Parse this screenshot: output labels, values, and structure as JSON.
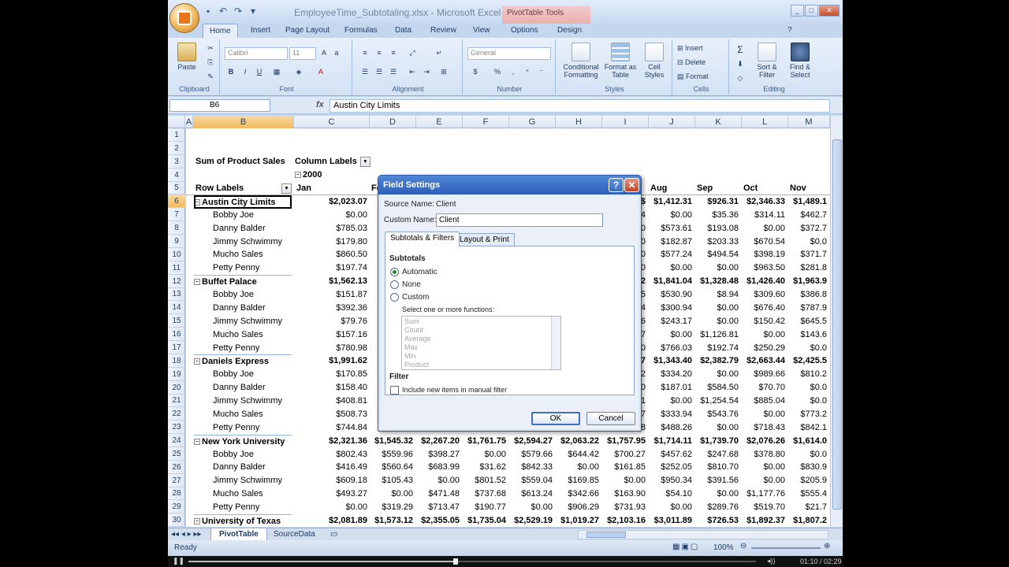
{
  "window": {
    "title": "EmployeeTime_Subtotaling.xlsx - Microsoft Excel",
    "context_tab": "PivotTable Tools"
  },
  "tabs": [
    "Home",
    "Insert",
    "Page Layout",
    "Formulas",
    "Data",
    "Review",
    "View",
    "Options",
    "Design"
  ],
  "ribbon": {
    "clipboard": {
      "label": "Clipboard",
      "paste": "Paste"
    },
    "font": {
      "label": "Font",
      "font_name": "Calibri",
      "font_size": "11"
    },
    "alignment": {
      "label": "Alignment"
    },
    "number": {
      "label": "Number",
      "format": "General"
    },
    "styles": {
      "label": "Styles",
      "conditional": "Conditional Formatting",
      "format_table": "Format as Table",
      "cell_styles": "Cell Styles"
    },
    "cells": {
      "label": "Cells",
      "insert": "Insert",
      "delete": "Delete",
      "format": "Format"
    },
    "editing": {
      "label": "Editing",
      "sort": "Sort & Filter",
      "find": "Find & Select"
    }
  },
  "formula_bar": {
    "name_box": "B6",
    "fx": "fx",
    "content": "Austin City Limits"
  },
  "columns": [
    "A",
    "B",
    "C",
    "D",
    "E",
    "F",
    "G",
    "H",
    "I",
    "J",
    "K",
    "L",
    "M"
  ],
  "rows": [
    "1",
    "2",
    "3",
    "4",
    "5",
    "6",
    "7",
    "8",
    "9",
    "10",
    "11",
    "12",
    "13",
    "14",
    "15",
    "16",
    "17",
    "18",
    "19",
    "20",
    "21",
    "22",
    "23",
    "24",
    "25",
    "26",
    "27",
    "28",
    "29",
    "30"
  ],
  "pivot": {
    "sum_label": "Sum of Product Sales",
    "col_labels": "Column Labels",
    "year": "2000",
    "row_labels": "Row Labels",
    "months": [
      "Jan",
      "Feb",
      "Mar",
      "Apr",
      "May",
      "Jun",
      "Jul",
      "Aug",
      "Sep",
      "Oct",
      "Nov"
    ],
    "rows": [
      {
        "label": "Austin City Limits",
        "type": "parent",
        "v": [
          "$2,023.07",
          "",
          "",
          "",
          "",
          "",
          "$",
          "$1,412.31",
          "$926.31",
          "$2,346.33",
          "$1,489.1"
        ]
      },
      {
        "label": "Bobby Joe",
        "type": "child",
        "v": [
          "$0.00",
          "",
          "",
          "",
          "",
          "",
          "4",
          "$0.00",
          "$35.36",
          "$314.11",
          "$462.7"
        ]
      },
      {
        "label": "Danny Balder",
        "type": "child",
        "v": [
          "$785.03",
          "",
          "",
          "",
          "",
          "",
          "0",
          "$573.61",
          "$193.08",
          "$0.00",
          "$372.7"
        ]
      },
      {
        "label": "Jimmy Schwimmy",
        "type": "child",
        "v": [
          "$179.80",
          "",
          "",
          "",
          "",
          "",
          "0",
          "$182.87",
          "$203.33",
          "$670.54",
          "$0.0"
        ]
      },
      {
        "label": "Mucho Sales",
        "type": "child",
        "v": [
          "$860.50",
          "",
          "",
          "",
          "",
          "",
          "0",
          "$577.24",
          "$494.54",
          "$398.19",
          "$371.7"
        ]
      },
      {
        "label": "Petty Penny",
        "type": "child",
        "v": [
          "$197.74",
          "",
          "",
          "",
          "",
          "",
          "0",
          "$0.00",
          "$0.00",
          "$963.50",
          "$281.8"
        ]
      },
      {
        "label": "Buffet Palace",
        "type": "parent",
        "v": [
          "$1,562.13",
          "",
          "",
          "",
          "",
          "",
          "2",
          "$1,841.04",
          "$1,328.48",
          "$1,426.40",
          "$1,963.9"
        ]
      },
      {
        "label": "Bobby Joe",
        "type": "child",
        "v": [
          "$151.87",
          "",
          "",
          "",
          "",
          "",
          "5",
          "$530.90",
          "$8.94",
          "$309.60",
          "$386.8"
        ]
      },
      {
        "label": "Danny Balder",
        "type": "child",
        "v": [
          "$392.36",
          "",
          "",
          "",
          "",
          "",
          "4",
          "$300.94",
          "$0.00",
          "$676.40",
          "$787.9"
        ]
      },
      {
        "label": "Jimmy Schwimmy",
        "type": "child",
        "v": [
          "$79.76",
          "",
          "",
          "",
          "",
          "",
          "6",
          "$243.17",
          "$0.00",
          "$150.42",
          "$645.5"
        ]
      },
      {
        "label": "Mucho Sales",
        "type": "child",
        "v": [
          "$157.16",
          "",
          "",
          "",
          "",
          "",
          "7",
          "$0.00",
          "$1,126.81",
          "$0.00",
          "$143.6"
        ]
      },
      {
        "label": "Petty Penny",
        "type": "child",
        "v": [
          "$780.98",
          "",
          "",
          "",
          "",
          "",
          "0",
          "$766.03",
          "$192.74",
          "$250.29",
          "$0.0"
        ]
      },
      {
        "label": "Daniels Express",
        "type": "parent",
        "v": [
          "$1,991.62",
          "",
          "",
          "",
          "",
          "",
          "7",
          "$1,343.40",
          "$2,382.79",
          "$2,663.44",
          "$2,425.5"
        ]
      },
      {
        "label": "Bobby Joe",
        "type": "child",
        "v": [
          "$170.85",
          "",
          "",
          "",
          "",
          "",
          "2",
          "$334.20",
          "$0.00",
          "$989.66",
          "$810.2"
        ]
      },
      {
        "label": "Danny Balder",
        "type": "child",
        "v": [
          "$158.40",
          "",
          "",
          "",
          "",
          "",
          "0",
          "$187.01",
          "$584.50",
          "$70.70",
          "$0.0"
        ]
      },
      {
        "label": "Jimmy Schwimmy",
        "type": "child",
        "v": [
          "$408.81",
          "",
          "",
          "",
          "",
          "",
          "1",
          "$0.00",
          "$1,254.54",
          "$885.04",
          "$0.0"
        ]
      },
      {
        "label": "Mucho Sales",
        "type": "child",
        "v": [
          "$508.73",
          "",
          "",
          "",
          "",
          "",
          "7",
          "$333.94",
          "$543.76",
          "$0.00",
          "$773.2"
        ]
      },
      {
        "label": "Petty Penny",
        "type": "child",
        "v": [
          "$744.84",
          "",
          "",
          "",
          "",
          "",
          "8",
          "$488.26",
          "$0.00",
          "$718.43",
          "$842.1"
        ]
      },
      {
        "label": "New York University",
        "type": "parent",
        "v": [
          "$2,321.36",
          "$1,545.32",
          "$2,267.20",
          "$1,761.75",
          "$2,594.27",
          "$2,063.22",
          "$1,757.95",
          "$1,714.11",
          "$1,739.70",
          "$2,076.26",
          "$1,614.0"
        ]
      },
      {
        "label": "Bobby Joe",
        "type": "child",
        "v": [
          "$802.43",
          "$559.96",
          "$398.27",
          "$0.00",
          "$579.66",
          "$644.42",
          "$700.27",
          "$457.62",
          "$247.68",
          "$378.80",
          "$0.0"
        ]
      },
      {
        "label": "Danny Balder",
        "type": "child",
        "v": [
          "$416.49",
          "$560.64",
          "$683.99",
          "$31.62",
          "$842.33",
          "$0.00",
          "$161.85",
          "$252.05",
          "$810.70",
          "$0.00",
          "$830.9"
        ]
      },
      {
        "label": "Jimmy Schwimmy",
        "type": "child",
        "v": [
          "$609.18",
          "$105.43",
          "$0.00",
          "$801.52",
          "$559.04",
          "$169.85",
          "$0.00",
          "$950.34",
          "$391.56",
          "$0.00",
          "$205.9"
        ]
      },
      {
        "label": "Mucho Sales",
        "type": "child",
        "v": [
          "$493.27",
          "$0.00",
          "$471.48",
          "$737.68",
          "$613.24",
          "$342.66",
          "$163.90",
          "$54.10",
          "$0.00",
          "$1,177.76",
          "$555.4"
        ]
      },
      {
        "label": "Petty Penny",
        "type": "child",
        "v": [
          "$0.00",
          "$319.29",
          "$713.47",
          "$190.77",
          "$0.00",
          "$906.29",
          "$731.93",
          "$0.00",
          "$289.76",
          "$519.70",
          "$21.7"
        ]
      },
      {
        "label": "University of Texas",
        "type": "parent",
        "v": [
          "$2,081.89",
          "$1,573.12",
          "$2,355.05",
          "$1,735.04",
          "$2,529.19",
          "$1,019.27",
          "$2,103.16",
          "$3,011.89",
          "$726.53",
          "$1,892.37",
          "$1,807.2"
        ]
      }
    ]
  },
  "sheets": [
    "PivotTable",
    "SourceData"
  ],
  "status": {
    "ready": "Ready",
    "zoom": "100%"
  },
  "player": {
    "time": "01:10 / 02:29"
  },
  "dialog": {
    "title": "Field Settings",
    "source_label": "Source Name:",
    "source_value": "Client",
    "custom_label": "Custom Name:",
    "custom_value": "Client",
    "tab_subtotals": "Subtotals & Filters",
    "tab_layout": "Layout & Print",
    "subtotals_heading": "Subtotals",
    "opt_automatic": "Automatic",
    "opt_none": "None",
    "opt_custom": "Custom",
    "select_label": "Select one or more functions:",
    "functions": [
      "Sum",
      "Count",
      "Average",
      "Max",
      "Min",
      "Product"
    ],
    "filter_heading": "Filter",
    "include_label": "Include new items in manual filter",
    "ok": "OK",
    "cancel": "Cancel",
    "help": "?",
    "close": "✕"
  }
}
